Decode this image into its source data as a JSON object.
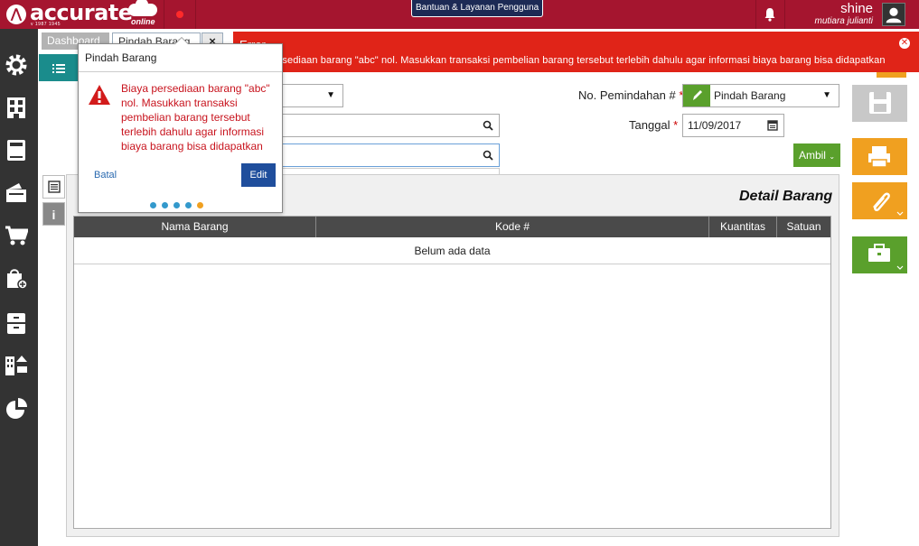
{
  "app": {
    "logo_text": "accurate",
    "logo_sub": "online",
    "logo_version": "v 1987 1945",
    "help_label": "Bantuan & Layanan Pengguna",
    "user_name": "shine",
    "user_sub": "mutiara julianti"
  },
  "tabs": [
    {
      "label": "Dashboard"
    },
    {
      "label": "Pindah Barang"
    }
  ],
  "tab_close": "×",
  "form": {
    "no_label": "No. Pemindahan #",
    "no_value": "Pindah Barang",
    "tanggal_label": "Tanggal",
    "tanggal_value": "11/09/2017",
    "required_mark": "*",
    "ambil_label": "Ambil"
  },
  "detail": {
    "title": "Detail Barang",
    "columns": [
      "Nama Barang",
      "Kode #",
      "Kuantitas",
      "Satuan"
    ],
    "empty_text": "Belum ada data"
  },
  "error": {
    "title": "Error",
    "message": "Biaya persediaan barang \"abc\" nol. Masukkan transaksi pembelian barang tersebut terlebih dahulu agar informasi biaya barang bisa didapatkan"
  },
  "popover": {
    "title": "Pindah Barang",
    "message": "Biaya persediaan barang \"abc\" nol. Masukkan transaksi pembelian barang tersebut terlebih dahulu agar informasi biaya barang bisa didapatkan",
    "cancel_label": "Batal",
    "edit_label": "Edit",
    "pager": {
      "total": 5,
      "active": 5
    }
  },
  "colors": {
    "topbar": "#a5152f",
    "sidebar": "#333333",
    "error": "#e02418",
    "green": "#5aa02c",
    "orange": "#f0a020",
    "teal": "#1a8c8c"
  },
  "icons": {
    "sidebar": [
      "gear-icon",
      "building-icon",
      "book-icon",
      "wallet-icon",
      "cart-icon",
      "shopping-bag-add-icon",
      "archive-icon",
      "city-icon",
      "pie-chart-icon"
    ],
    "actions": [
      "save-icon",
      "print-icon",
      "paperclip-icon",
      "briefcase-icon"
    ]
  }
}
